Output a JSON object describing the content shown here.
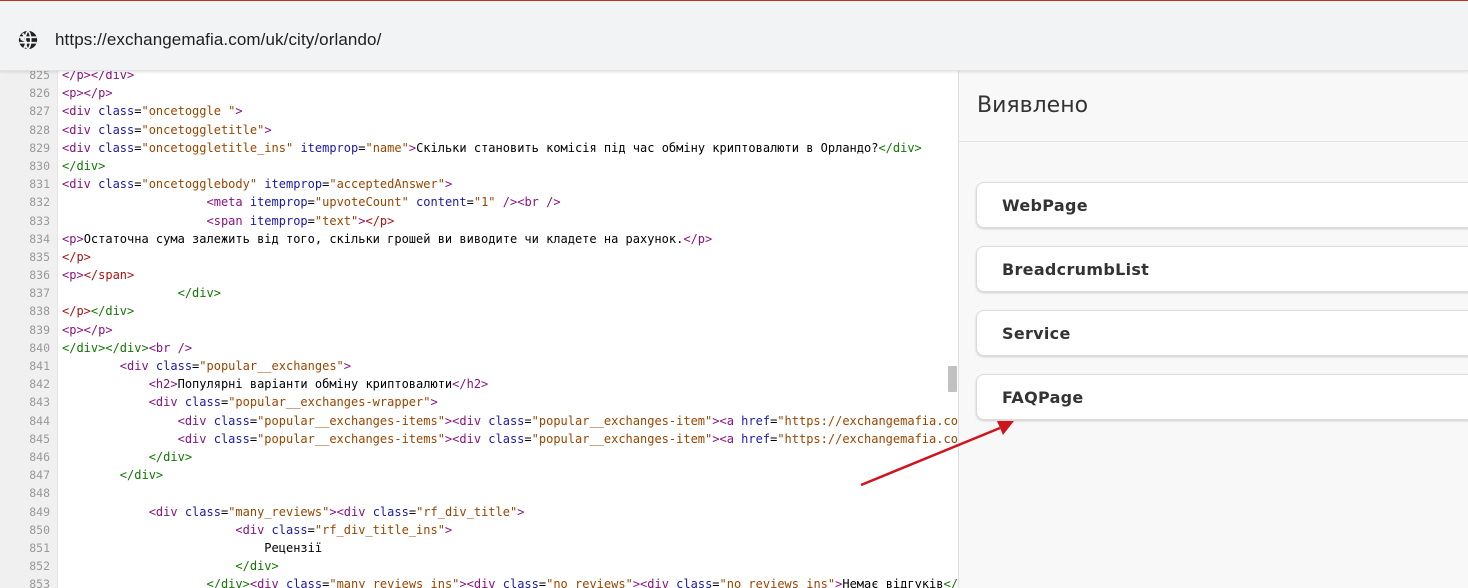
{
  "browser": {
    "url": "https://exchangemafia.com/uk/city/orlando/",
    "site_icon": "globe-icon"
  },
  "source": {
    "lines": [
      {
        "n": "825",
        "html": "<span class=\"tg\">&lt;/p&gt;&lt;/div&gt;</span>"
      },
      {
        "n": "826",
        "html": "<span class=\"tg\">&lt;p&gt;&lt;/p&gt;</span>"
      },
      {
        "n": "827",
        "html": "<span class=\"tg\">&lt;div </span><span class=\"ta\">class</span>=<span class=\"tv\">\"oncetoggle \"</span><span class=\"tg\">&gt;</span>"
      },
      {
        "n": "828",
        "html": "<span class=\"tg\">&lt;div </span><span class=\"ta\">class</span>=<span class=\"tv\">\"oncetoggletitle\"</span><span class=\"tg\">&gt;</span>"
      },
      {
        "n": "829",
        "html": "<span class=\"tg\">&lt;div </span><span class=\"ta\">class</span>=<span class=\"tv\">\"oncetoggletitle_ins\"</span> <span class=\"ta\">itemprop</span>=<span class=\"tv\">\"name\"</span><span class=\"tg\">&gt;</span>Скільки становить комісія під час обміну криптовалюти в Орландо?<span class=\"tgn\">&lt;/div&gt;</span>"
      },
      {
        "n": "830",
        "html": "<span class=\"tgn\">&lt;/div&gt;</span>"
      },
      {
        "n": "831",
        "html": "<span class=\"tg\">&lt;div </span><span class=\"ta\">class</span>=<span class=\"tv\">\"oncetogglebody\"</span> <span class=\"ta\">itemprop</span>=<span class=\"tv\">\"acceptedAnswer\"</span><span class=\"tg\">&gt;</span>"
      },
      {
        "n": "832",
        "html": "                    <span class=\"tg\">&lt;meta </span><span class=\"ta\">itemprop</span>=<span class=\"tv\">\"upvoteCount\"</span> <span class=\"ta\">content</span>=<span class=\"tv\">\"1\"</span> <span class=\"tg\">/&gt;&lt;br /&gt;</span>"
      },
      {
        "n": "833",
        "html": "                    <span class=\"tg\">&lt;span </span><span class=\"ta\">itemprop</span>=<span class=\"tv\">\"text\"</span><span class=\"tg\">&gt;</span><span class=\"tgr\">&lt;/p&gt;</span>"
      },
      {
        "n": "834",
        "html": "<span class=\"tg\">&lt;p&gt;</span>Остаточна сума залежить від того, скільки грошей ви виводите чи кладете на рахунок.<span class=\"tg\">&lt;/p&gt;</span>"
      },
      {
        "n": "835",
        "html": "<span class=\"tgr\">&lt;/p&gt;</span>"
      },
      {
        "n": "836",
        "html": "<span class=\"tg\">&lt;p&gt;</span><span class=\"tgr\">&lt;/span&gt;</span>"
      },
      {
        "n": "837",
        "html": "                <span class=\"tgn\">&lt;/div&gt;</span>"
      },
      {
        "n": "838",
        "html": "<span class=\"tgr\">&lt;/p&gt;</span><span class=\"tgn\">&lt;/div&gt;</span>"
      },
      {
        "n": "839",
        "html": "<span class=\"tg\">&lt;p&gt;&lt;/p&gt;</span>"
      },
      {
        "n": "840",
        "html": "<span class=\"tgn\">&lt;/div&gt;&lt;/div&gt;</span><span class=\"tg\">&lt;br /&gt;</span>"
      },
      {
        "n": "841",
        "html": "        <span class=\"tg\">&lt;div </span><span class=\"ta\">class</span>=<span class=\"tv\">\"popular__exchanges\"</span><span class=\"tg\">&gt;</span>"
      },
      {
        "n": "842",
        "html": "            <span class=\"tg\">&lt;h2&gt;</span>Популярні варіанти обміну криптовалюти<span class=\"tg\">&lt;/h2&gt;</span>"
      },
      {
        "n": "843",
        "html": "            <span class=\"tg\">&lt;div </span><span class=\"ta\">class</span>=<span class=\"tv\">\"popular__exchanges-wrapper\"</span><span class=\"tg\">&gt;</span>"
      },
      {
        "n": "844",
        "html": "                <span class=\"tg\">&lt;div </span><span class=\"ta\">class</span>=<span class=\"tv\">\"popular__exchanges-items\"</span><span class=\"tg\">&gt;&lt;div </span><span class=\"ta\">class</span>=<span class=\"tv\">\"popular__exchanges-item\"</span><span class=\"tg\">&gt;&lt;a </span><span class=\"ta\">href</span>=<span class=\"tv\">\"https://exchangemafia.com/</span>"
      },
      {
        "n": "845",
        "html": "                <span class=\"tg\">&lt;div </span><span class=\"ta\">class</span>=<span class=\"tv\">\"popular__exchanges-items\"</span><span class=\"tg\">&gt;&lt;div </span><span class=\"ta\">class</span>=<span class=\"tv\">\"popular__exchanges-item\"</span><span class=\"tg\">&gt;&lt;a </span><span class=\"ta\">href</span>=<span class=\"tv\">\"https://exchangemafia.com/</span>"
      },
      {
        "n": "846",
        "html": "            <span class=\"tgn\">&lt;/div&gt;</span>"
      },
      {
        "n": "847",
        "html": "        <span class=\"tgn\">&lt;/div&gt;</span>"
      },
      {
        "n": "848",
        "html": ""
      },
      {
        "n": "849",
        "html": "            <span class=\"tg\">&lt;div </span><span class=\"ta\">class</span>=<span class=\"tv\">\"many_reviews\"</span><span class=\"tg\">&gt;&lt;div </span><span class=\"ta\">class</span>=<span class=\"tv\">\"rf_div_title\"</span><span class=\"tg\">&gt;</span>"
      },
      {
        "n": "850",
        "html": "                        <span class=\"tg\">&lt;div </span><span class=\"ta\">class</span>=<span class=\"tv\">\"rf_div_title_ins\"</span><span class=\"tg\">&gt;</span>"
      },
      {
        "n": "851",
        "html": "                            Рецензії"
      },
      {
        "n": "852",
        "html": "                        <span class=\"tgn\">&lt;/div&gt;</span>"
      },
      {
        "n": "853",
        "html": "                    <span class=\"tgn\">&lt;/div&gt;</span><span class=\"tg\">&lt;div </span><span class=\"ta\">class</span>=<span class=\"tv\">\"many_reviews_ins\"</span><span class=\"tg\">&gt;&lt;div </span><span class=\"ta\">class</span>=<span class=\"tv\">\"no_reviews\"</span><span class=\"tg\">&gt;&lt;div </span><span class=\"ta\">class</span>=<span class=\"tv\">\"no_reviews_ins\"</span><span class=\"tg\">&gt;</span>Немає відгуків<span class=\"tgn\">&lt;/di</span>"
      }
    ]
  },
  "panel": {
    "title": "Виявлено",
    "items": [
      {
        "label": "WebPage"
      },
      {
        "label": "BreadcrumbList"
      },
      {
        "label": "Service"
      },
      {
        "label": "FAQPage"
      }
    ]
  },
  "annotation": {
    "arrow_color": "#d0141c"
  }
}
